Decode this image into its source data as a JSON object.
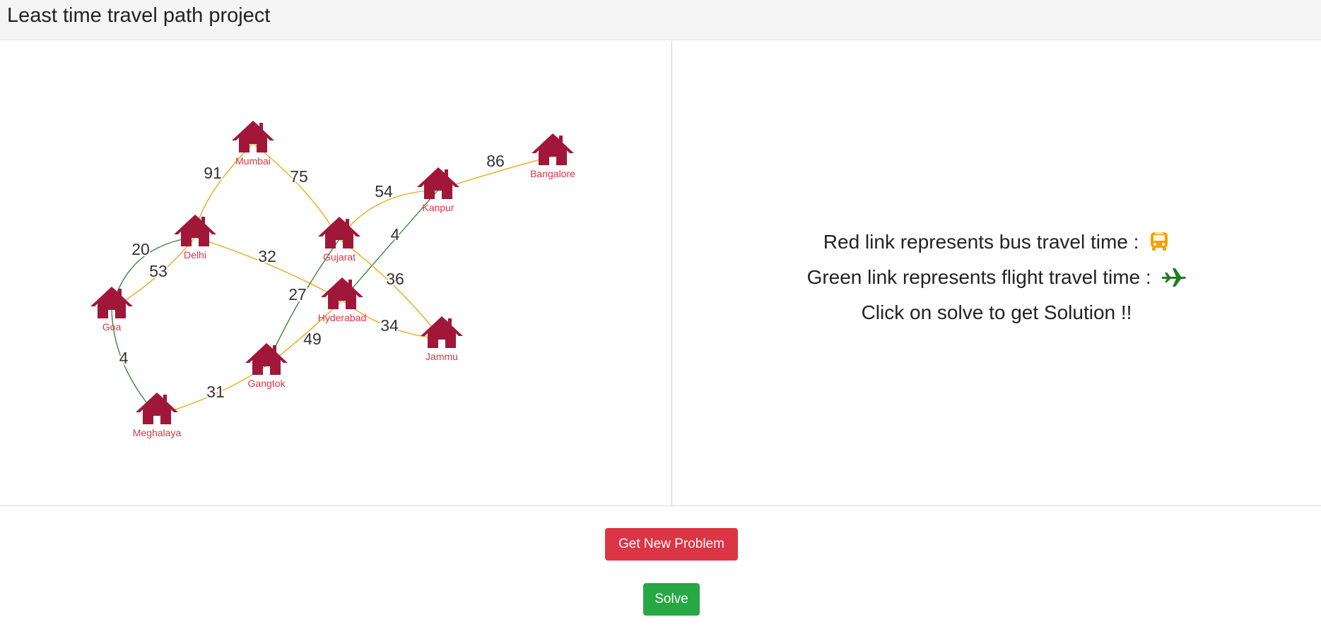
{
  "app": {
    "title": "Least time travel path project"
  },
  "graph": {
    "nodes": [
      {
        "id": "Mumbai",
        "label": "Mumbai"
      },
      {
        "id": "Bangalore",
        "label": "Bangalore"
      },
      {
        "id": "Kanpur",
        "label": "Kanpur"
      },
      {
        "id": "Delhi",
        "label": "Delhi"
      },
      {
        "id": "Gujarat",
        "label": "Gujarat"
      },
      {
        "id": "Goa",
        "label": "Goa"
      },
      {
        "id": "Hyderabad",
        "label": "Hyderabad"
      },
      {
        "id": "Jammu",
        "label": "Jammu"
      },
      {
        "id": "Gangtok",
        "label": "Gangtok"
      },
      {
        "id": "Meghalaya",
        "label": "Meghalaya"
      }
    ],
    "edges": [
      {
        "from": "Mumbai",
        "to": "Delhi",
        "weight": "91",
        "mode": "bus"
      },
      {
        "from": "Mumbai",
        "to": "Gujarat",
        "weight": "75",
        "mode": "bus"
      },
      {
        "from": "Kanpur",
        "to": "Bangalore",
        "weight": "86",
        "mode": "bus"
      },
      {
        "from": "Gujarat",
        "to": "Kanpur",
        "weight": "54",
        "mode": "bus"
      },
      {
        "from": "Kanpur",
        "to": "Hyderabad",
        "weight": "4",
        "mode": "flight"
      },
      {
        "from": "Delhi",
        "to": "Hyderabad",
        "weight": "32",
        "mode": "bus"
      },
      {
        "from": "Gujarat",
        "to": "Jammu",
        "weight": "36",
        "mode": "bus"
      },
      {
        "from": "Delhi",
        "to": "Goa",
        "weight": "20",
        "mode": "flight"
      },
      {
        "from": "Delhi",
        "to": "Goa",
        "weight": "53",
        "mode": "bus"
      },
      {
        "from": "Gujarat",
        "to": "Gangtok",
        "weight": "27",
        "mode": "flight"
      },
      {
        "from": "Hyderabad",
        "to": "Jammu",
        "weight": "34",
        "mode": "bus"
      },
      {
        "from": "Hyderabad",
        "to": "Gangtok",
        "weight": "49",
        "mode": "bus"
      },
      {
        "from": "Goa",
        "to": "Meghalaya",
        "weight": "4",
        "mode": "flight"
      },
      {
        "from": "Meghalaya",
        "to": "Gangtok",
        "weight": "31",
        "mode": "bus"
      }
    ],
    "colors": {
      "bus": "#f0a30a",
      "flight": "#2e7d32",
      "node": "#a0173a",
      "node_label": "#dc3545",
      "weight_label": "#333333"
    },
    "icons": {
      "node": "house-icon"
    }
  },
  "info": {
    "bus_line": "Red link represents bus travel time :",
    "flight_line": "Green link represents flight travel time :",
    "solve_line": "Click on solve to get Solution !!",
    "bus_icon": "bus-icon",
    "flight_icon": "airplane-icon",
    "bus_icon_color": "#f0a30a",
    "flight_icon_color": "#1e7d1e"
  },
  "buttons": {
    "new_problem": "Get New Problem",
    "solve": "Solve",
    "new_problem_color": "#dc3545",
    "solve_color": "#28a745"
  }
}
